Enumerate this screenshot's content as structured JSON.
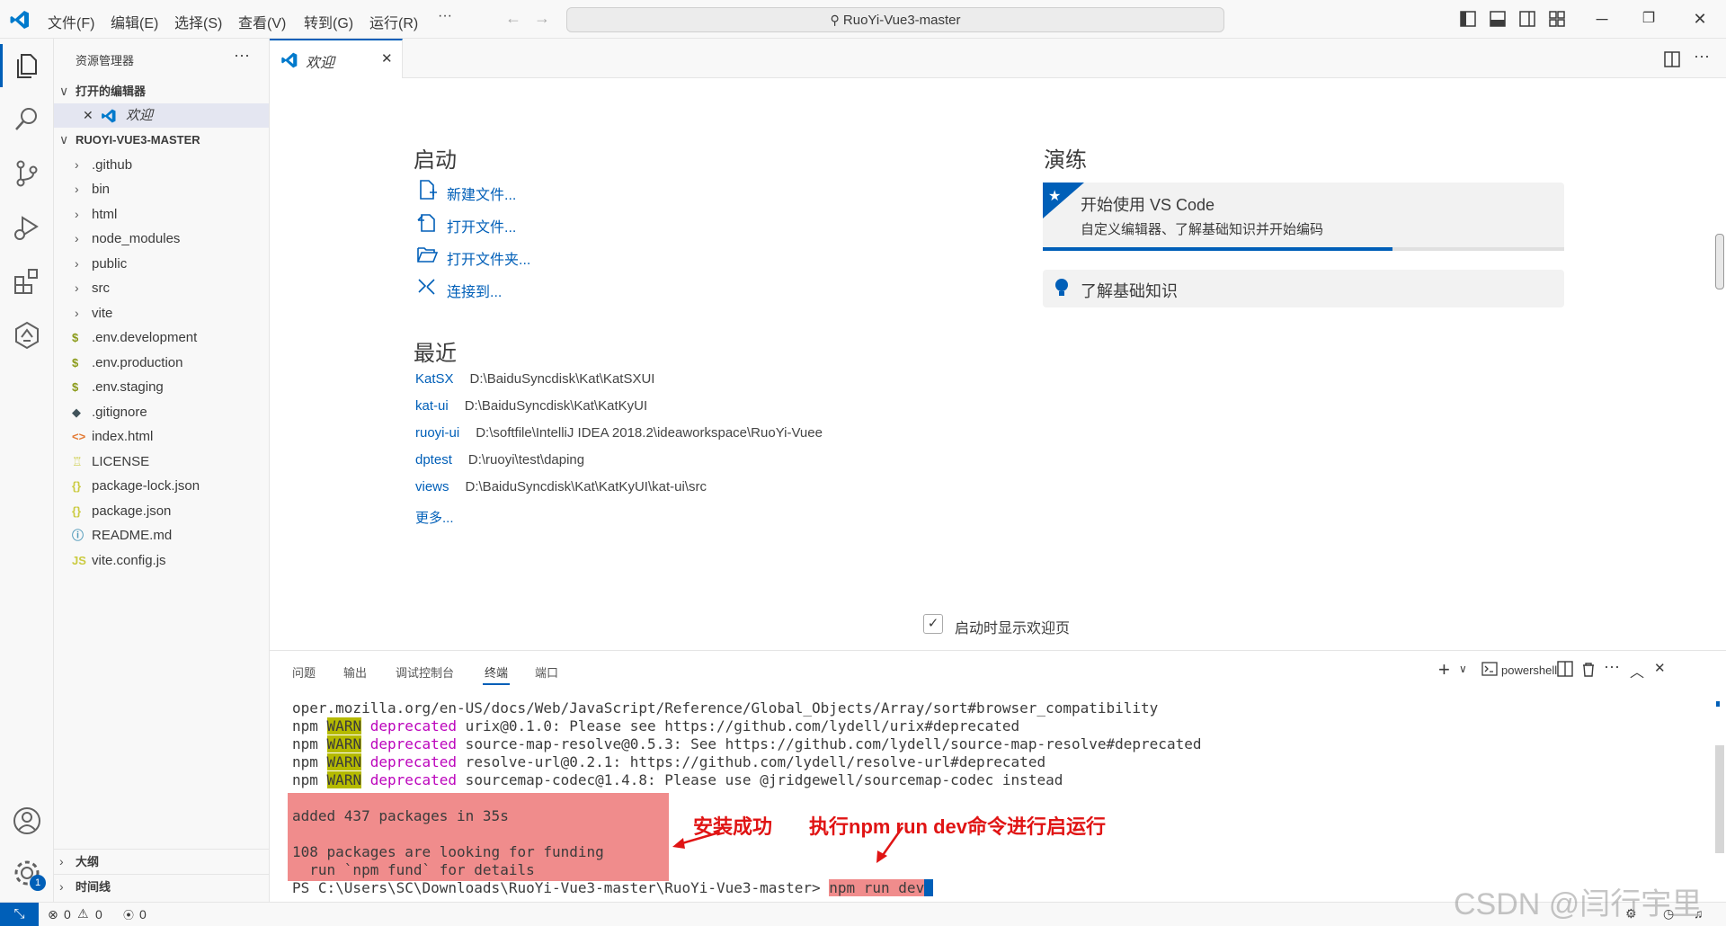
{
  "menu": [
    "文件(F)",
    "编辑(E)",
    "选择(S)",
    "查看(V)",
    "转到(G)",
    "运行(R)",
    "···"
  ],
  "search_title": "RuoYi-Vue3-master",
  "sidebar": {
    "title": "资源管理器",
    "open_editors_label": "打开的编辑器",
    "open_editor_item": "欢迎",
    "project_label": "RUOYI-VUE3-MASTER",
    "folders": [
      ".github",
      "bin",
      "html",
      "node_modules",
      "public",
      "src",
      "vite"
    ],
    "files": [
      {
        "name": ".env.development",
        "icon": "$",
        "color": "#8a9a18"
      },
      {
        "name": ".env.production",
        "icon": "$",
        "color": "#8a9a18"
      },
      {
        "name": ".env.staging",
        "icon": "$",
        "color": "#8a9a18"
      },
      {
        "name": ".gitignore",
        "icon": "◆",
        "color": "#41535b"
      },
      {
        "name": "index.html",
        "icon": "<>",
        "color": "#e37933"
      },
      {
        "name": "LICENSE",
        "icon": "♖",
        "color": "#cbcb41"
      },
      {
        "name": "package-lock.json",
        "icon": "{}",
        "color": "#cbcb41"
      },
      {
        "name": "package.json",
        "icon": "{}",
        "color": "#cbcb41"
      },
      {
        "name": "README.md",
        "icon": "ⓘ",
        "color": "#519aba"
      },
      {
        "name": "vite.config.js",
        "icon": "JS",
        "color": "#cbcb41"
      }
    ],
    "outline_label": "大纲",
    "timeline_label": "时间线"
  },
  "tab": {
    "label": "欢迎"
  },
  "welcome": {
    "start_heading": "启动",
    "start_items": [
      "新建文件...",
      "打开文件...",
      "打开文件夹...",
      "连接到..."
    ],
    "recent_heading": "最近",
    "recent": [
      {
        "name": "KatSX",
        "path": "D:\\BaiduSyncdisk\\Kat\\KatSXUI"
      },
      {
        "name": "kat-ui",
        "path": "D:\\BaiduSyncdisk\\Kat\\KatKyUI"
      },
      {
        "name": "ruoyi-ui",
        "path": "D:\\softfile\\IntelliJ IDEA 2018.2\\ideaworkspace\\RuoYi-Vuee"
      },
      {
        "name": "dptest",
        "path": "D:\\ruoyi\\test\\daping"
      },
      {
        "name": "views",
        "path": "D:\\BaiduSyncdisk\\Kat\\KatKyUI\\kat-ui\\src"
      }
    ],
    "more_label": "更多...",
    "walkthrough_heading": "演练",
    "card1_title": "开始使用 VS Code",
    "card1_desc": "自定义编辑器、了解基础知识并开始编码",
    "card1_progress": 0.67,
    "card2_title": "了解基础知识",
    "show_on_startup": "启动时显示欢迎页"
  },
  "panel": {
    "tabs": [
      "问题",
      "输出",
      "调试控制台",
      "终端",
      "端口"
    ],
    "active_tab": "终端",
    "shell_label": "powershell",
    "lines": {
      "l0": "oper.mozilla.org/en-US/docs/Web/JavaScript/Reference/Global_Objects/Array/sort#browser_compatibility",
      "npm": "npm",
      "warn": "WARN",
      "deprecated": "deprecated",
      "w1": " urix@0.1.0: Please see https://github.com/lydell/urix#deprecated",
      "w2": " source-map-resolve@0.5.3: See https://github.com/lydell/source-map-resolve#deprecated",
      "w3": " resolve-url@0.2.1: https://github.com/lydell/resolve-url#deprecated",
      "w4": " sourcemap-codec@1.4.8: Please use @jridgewell/sourcemap-codec instead",
      "added": "added 437 packages in 35s",
      "funding1": "108 packages are looking for funding",
      "funding2": "  run `npm fund` for details",
      "prompt": "PS C:\\Users\\SC\\Downloads\\RuoYi-Vue3-master\\RuoYi-Vue3-master> ",
      "command": "npm run dev"
    },
    "annotation_install": "安装成功",
    "annotation_run": "执行npm run dev命令进行启运行"
  },
  "status": {
    "errors": "0",
    "warnings": "0",
    "ports": "0"
  },
  "watermark": "CSDN @闫行宇里"
}
